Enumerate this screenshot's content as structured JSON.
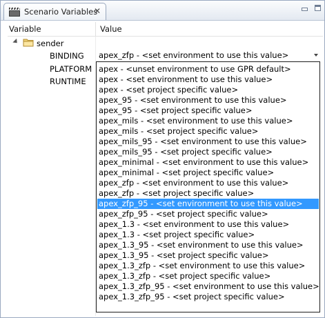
{
  "view": {
    "title": "Scenario Variables",
    "close_glyph": "✕",
    "tab_icon": "clapperboard-icon"
  },
  "table": {
    "headers": [
      "Variable",
      "Value"
    ],
    "group": {
      "label": "sender",
      "icon": "folder-icon",
      "expanded": true
    },
    "rows": [
      {
        "name": "BINDING",
        "value": "apex_zfp - <set environment to use this value>"
      },
      {
        "name": "PLATFORM",
        "value": ""
      },
      {
        "name": "RUNTIME",
        "value": ""
      }
    ]
  },
  "dropdown": {
    "selected_index": 13,
    "options": [
      "apex - <unset environment to use GPR default>",
      "apex - <set environment to use this value>",
      "apex - <set project specific value>",
      "apex_95 - <set environment to use this value>",
      "apex_95 - <set project specific value>",
      "apex_mils - <set environment to use this value>",
      "apex_mils - <set project specific value>",
      "apex_mils_95 - <set environment to use this value>",
      "apex_mils_95 - <set project specific value>",
      "apex_minimal - <set environment to use this value>",
      "apex_minimal - <set project specific value>",
      "apex_zfp - <set environment to use this value>",
      "apex_zfp - <set project specific value>",
      "apex_zfp_95 - <set environment to use this value>",
      "apex_zfp_95 - <set project specific value>",
      "apex_1.3 - <set environment to use this value>",
      "apex_1.3 - <set project specific value>",
      "apex_1.3_95 - <set environment to use this value>",
      "apex_1.3_95 - <set project specific value>",
      "apex_1.3_zfp - <set environment to use this value>",
      "apex_1.3_zfp - <set project specific value>",
      "apex_1.3_zfp_95 - <set environment to use this value>",
      "apex_1.3_zfp_95 - <set project specific value>"
    ]
  },
  "colors": {
    "selection": "#3399ff",
    "border": "#99a8c0"
  }
}
